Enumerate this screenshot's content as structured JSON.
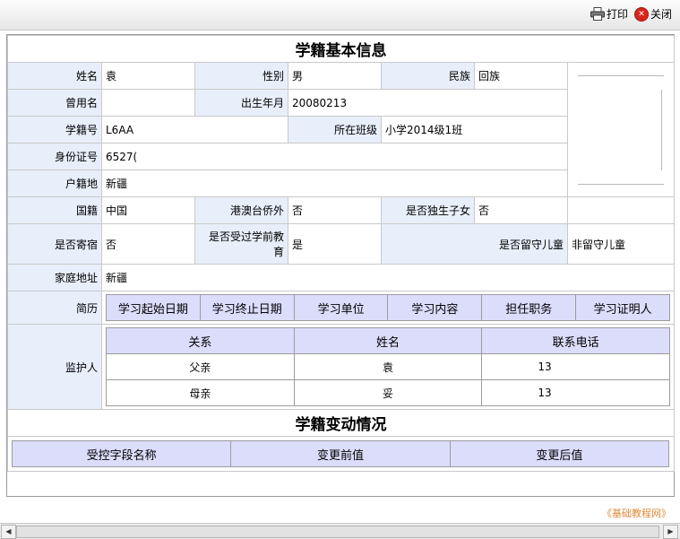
{
  "toolbar": {
    "print_label": "打印",
    "close_label": "关闭"
  },
  "basic": {
    "title": "学籍基本信息",
    "name_label": "姓名",
    "name_value": "袁",
    "gender_label": "性别",
    "gender_value": "男",
    "ethnic_label": "民族",
    "ethnic_value": "回族",
    "former_name_label": "曾用名",
    "former_name_value": "",
    "birth_label": "出生年月",
    "birth_value": "20080213",
    "student_no_label": "学籍号",
    "student_no_value": "L6AA",
    "class_label": "所在班级",
    "class_value": "小学2014级1班",
    "id_label": "身份证号",
    "id_value": "6527(",
    "hukou_label": "户籍地",
    "hukou_value": "新疆",
    "nationality_label": "国籍",
    "nationality_value": "中国",
    "hmt_label": "港澳台侨外",
    "hmt_value": "否",
    "only_child_label": "是否独生子女",
    "only_child_value": "否",
    "boarding_label": "是否寄宿",
    "boarding_value": "否",
    "preschool_label": "是否受过学前教育",
    "preschool_value": "是",
    "left_behind_label": "是否留守儿童",
    "left_behind_value": "非留守儿童",
    "address_label": "家庭地址",
    "address_value": "新疆",
    "resume_label": "简历",
    "resume_headers": [
      "学习起始日期",
      "学习终止日期",
      "学习单位",
      "学习内容",
      "担任职务",
      "学习证明人"
    ],
    "guardian_label": "监护人",
    "guardian_headers": [
      "关系",
      "姓名",
      "联系电话"
    ],
    "guardians": [
      {
        "relation": "父亲",
        "name": "袁",
        "phone": "13"
      },
      {
        "relation": "母亲",
        "name": "妥",
        "phone": "13"
      }
    ]
  },
  "changes": {
    "title": "学籍变动情况",
    "headers": [
      "受控字段名称",
      "变更前值",
      "变更后值"
    ]
  },
  "watermark": "《基础教程网》"
}
